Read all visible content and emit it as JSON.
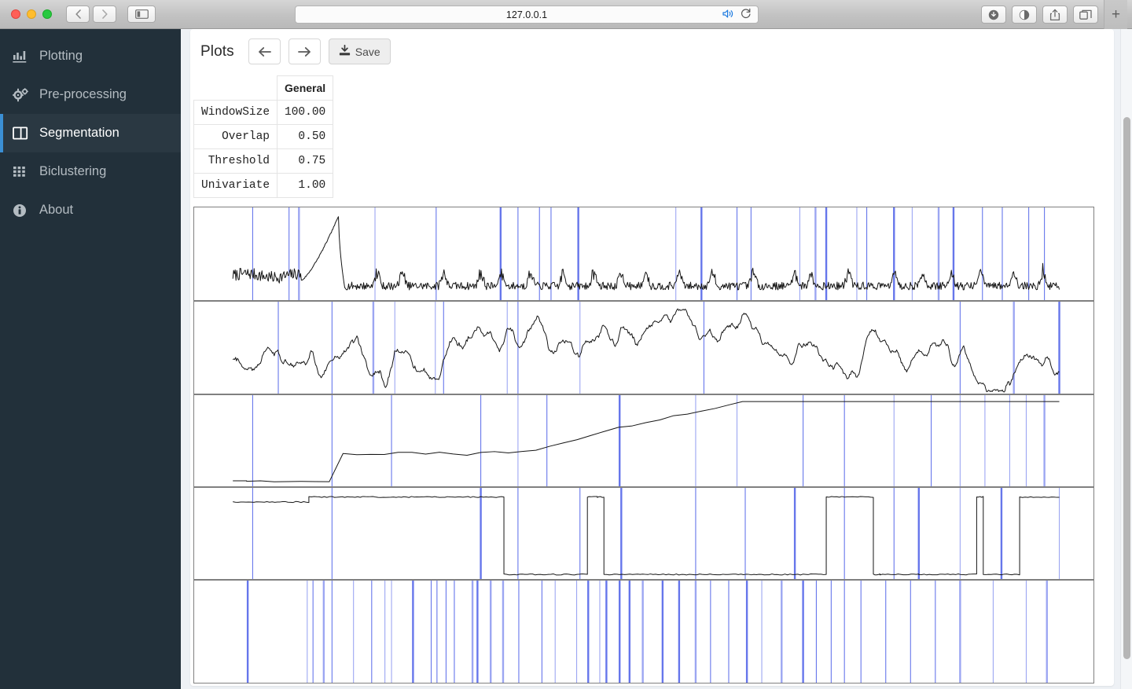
{
  "browser": {
    "url": "127.0.0.1",
    "back_label": "‹",
    "forward_label": "›",
    "sidebar_toggle_label": "▯",
    "audio_icon": "speaker-icon",
    "reload_icon": "reload-icon",
    "downloads_label": "⬇",
    "privacy_label": "◑",
    "share_label": "⬆",
    "tabs_label": "❐",
    "new_tab_label": "+"
  },
  "sidebar": {
    "items": [
      {
        "label": "Plotting",
        "icon": "chart-bar-icon",
        "active": false
      },
      {
        "label": "Pre-processing",
        "icon": "cogs-icon",
        "active": false
      },
      {
        "label": "Segmentation",
        "icon": "columns-icon",
        "active": true
      },
      {
        "label": "Biclustering",
        "icon": "grid-icon",
        "active": false
      },
      {
        "label": "About",
        "icon": "info-circle-icon",
        "active": false
      }
    ]
  },
  "toolbar": {
    "title": "Plots",
    "prev_label": "←",
    "next_label": "→",
    "save_label": "Save",
    "save_icon": "download-icon"
  },
  "params_table": {
    "corner": "",
    "columns": [
      "General"
    ],
    "rows": [
      {
        "name": "WindowSize",
        "values": [
          "100.00"
        ]
      },
      {
        "name": "Overlap",
        "values": [
          "0.50"
        ]
      },
      {
        "name": "Threshold",
        "values": [
          "0.75"
        ]
      },
      {
        "name": "Univariate",
        "values": [
          "1.00"
        ]
      }
    ]
  },
  "colors": {
    "sidebar_bg": "#22303a",
    "sidebar_active_bg": "#2a3842",
    "sidebar_accent": "#3b8fd4",
    "segment_line": "#4c5fe8",
    "signal_line": "#151515",
    "panel_border": "#808080",
    "page_bg": "#eef1f5"
  },
  "chart_data": [
    {
      "type": "line",
      "name": "signal-panel-1",
      "title": "",
      "xlabel": "",
      "ylabel": "",
      "xlim": [
        0,
        1000
      ],
      "ylim": [
        0,
        1
      ],
      "grid": false,
      "legend": "none",
      "segment_lines": [
        24,
        68,
        80,
        172,
        246,
        324,
        345,
        371,
        385,
        418,
        536,
        567,
        610,
        627,
        686,
        705,
        718,
        755,
        767,
        800,
        822,
        854,
        872,
        907,
        931,
        963,
        982
      ],
      "series": [
        {
          "name": "raw-signal",
          "color": "#151515",
          "baseline": 0.2,
          "noise": 0.06,
          "features": [
            {
              "kind": "burst",
              "x0": 40,
              "x1": 80,
              "peak": 0.95
            },
            {
              "kind": "noise_high",
              "x0": 0,
              "x1": 40,
              "level": 0.3
            },
            {
              "kind": "noise_low",
              "x0": 82,
              "x1": 1000,
              "level": 0.18
            }
          ]
        }
      ]
    },
    {
      "type": "line",
      "name": "signal-panel-2",
      "title": "",
      "xlabel": "",
      "ylabel": "",
      "xlim": [
        0,
        1000
      ],
      "ylim": [
        0,
        1
      ],
      "grid": false,
      "legend": "none",
      "segment_lines": [
        55,
        120,
        170,
        196,
        245,
        255,
        332,
        345,
        420,
        570,
        880,
        945,
        1000
      ],
      "series": [
        {
          "name": "random-walk",
          "color": "#151515",
          "baseline": 0.45,
          "noise": 0.22,
          "features": []
        }
      ]
    },
    {
      "type": "step",
      "name": "signal-panel-3",
      "title": "",
      "xlabel": "",
      "ylabel": "",
      "xlim": [
        0,
        1000
      ],
      "ylim": [
        0,
        1
      ],
      "grid": false,
      "legend": "none",
      "segment_lines": [
        24,
        120,
        192,
        300,
        345,
        380,
        468,
        560,
        610,
        690,
        740,
        800,
        845,
        880,
        910,
        940,
        960,
        982
      ],
      "series": [
        {
          "name": "cumulative-steps",
          "color": "#151515",
          "start_level": 0.06,
          "end_level": 0.93,
          "step_count": 46
        }
      ]
    },
    {
      "type": "step",
      "name": "signal-panel-4",
      "title": "",
      "xlabel": "",
      "ylabel": "",
      "xlim": [
        0,
        1000
      ],
      "ylim": [
        0,
        1
      ],
      "grid": false,
      "legend": "none",
      "segment_lines": [
        24,
        120,
        300,
        345,
        420,
        470,
        560,
        620,
        680,
        740,
        800,
        830,
        880,
        930,
        1000
      ],
      "series": [
        {
          "name": "binary-state",
          "color": "#151515",
          "high": 0.9,
          "low": 0.06,
          "transitions": [
            [
              0,
              85,
              "high"
            ],
            [
              85,
              300,
              "high"
            ],
            [
              300,
              425,
              "low"
            ],
            [
              425,
              432,
              "high"
            ],
            [
              437,
              443,
              "high"
            ],
            [
              443,
              620,
              "low"
            ],
            [
              620,
              685,
              "high"
            ],
            [
              685,
              800,
              "low"
            ],
            [
              800,
              880,
              "low"
            ],
            [
              880,
              890,
              "high"
            ],
            [
              900,
              940,
              "high"
            ],
            [
              940,
              955,
              "high"
            ],
            [
              955,
              1000,
              "high"
            ]
          ]
        }
      ]
    },
    {
      "type": "line",
      "name": "segments-panel-5",
      "title": "",
      "xlabel": "",
      "ylabel": "",
      "xlim": [
        0,
        1000
      ],
      "ylim": [
        0,
        1
      ],
      "grid": false,
      "legend": "none",
      "segment_lines": [
        18,
        90,
        97,
        110,
        120,
        146,
        168,
        184,
        192,
        218,
        240,
        247,
        258,
        268,
        290,
        296,
        312,
        327,
        346,
        374,
        390,
        416,
        430,
        444,
        452,
        468,
        480,
        496,
        520,
        540,
        560,
        578,
        600,
        622,
        640,
        664,
        690,
        706,
        724,
        740,
        760,
        790,
        820,
        850,
        880,
        920,
        960,
        985
      ],
      "series": []
    }
  ]
}
